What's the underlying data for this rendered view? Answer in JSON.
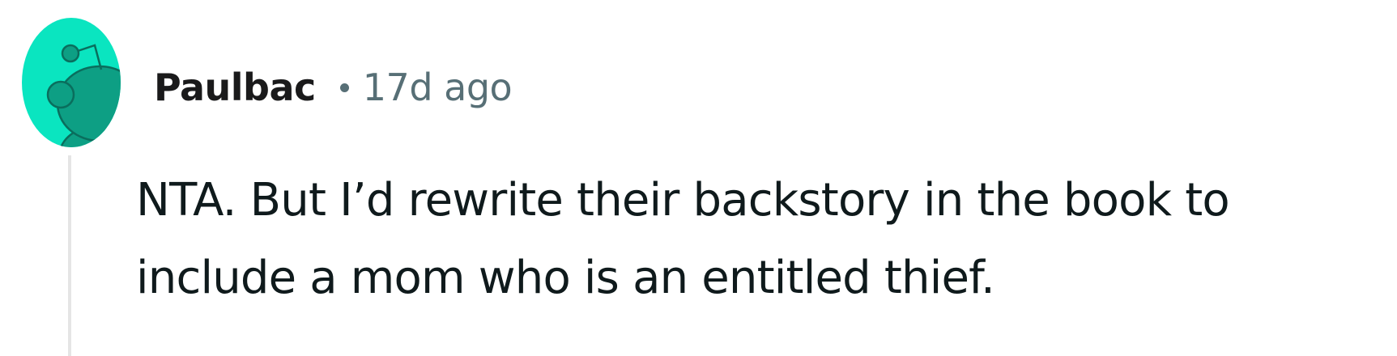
{
  "comment": {
    "avatar_icon": "snoo-avatar-icon",
    "avatar_color": "#0ae5c0",
    "username": "Paulbac",
    "timestamp": "17d ago",
    "body": "NTA. But I’d rewrite their backstory in the book to include a mom who is an entitled thief."
  }
}
